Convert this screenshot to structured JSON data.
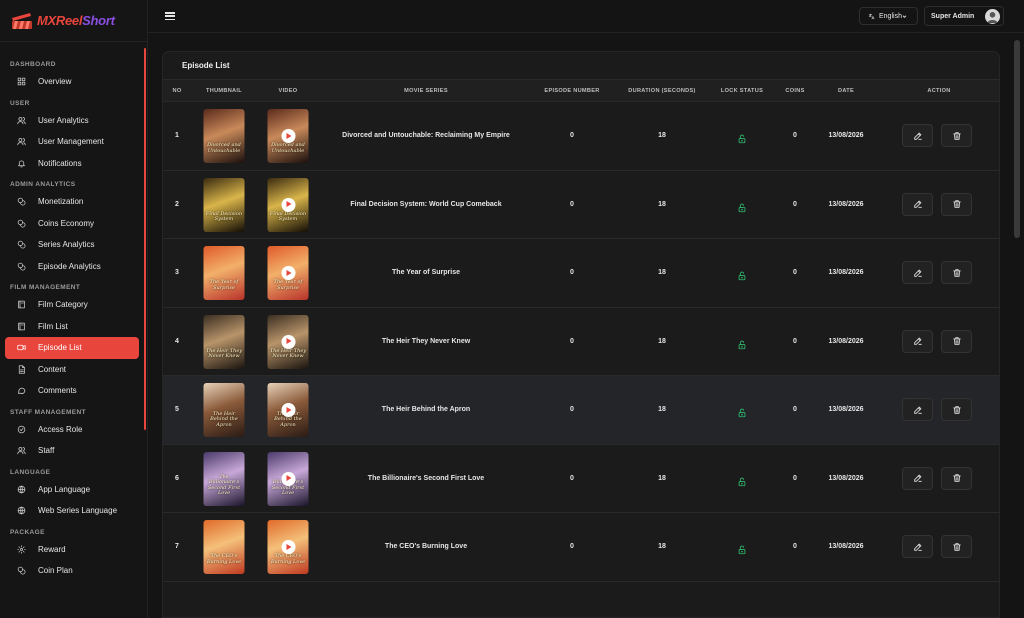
{
  "app": {
    "logo_main": "MXReel",
    "logo_sub": "Short"
  },
  "sidebar": {
    "sections": [
      {
        "label": "DASHBOARD",
        "items": [
          {
            "label": "Overview",
            "icon": "grid-icon"
          }
        ]
      },
      {
        "label": "USER",
        "items": [
          {
            "label": "User Analytics",
            "icon": "users-icon"
          },
          {
            "label": "User Management",
            "icon": "users-icon"
          },
          {
            "label": "Notifications",
            "icon": "bell-icon"
          }
        ]
      },
      {
        "label": "ADMIN ANALYTICS",
        "items": [
          {
            "label": "Monetization",
            "icon": "coins-icon"
          },
          {
            "label": "Coins Economy",
            "icon": "coins-icon"
          },
          {
            "label": "Series Analytics",
            "icon": "coins-icon"
          },
          {
            "label": "Episode Analytics",
            "icon": "coins-icon"
          }
        ]
      },
      {
        "label": "FILM MANAGEMENT",
        "items": [
          {
            "label": "Film Category",
            "icon": "book-icon"
          },
          {
            "label": "Film List",
            "icon": "book-icon"
          },
          {
            "label": "Episode List",
            "icon": "video-icon",
            "active": true
          },
          {
            "label": "Content",
            "icon": "file-icon"
          },
          {
            "label": "Comments",
            "icon": "comment-icon"
          }
        ]
      },
      {
        "label": "STAFF MANAGEMENT",
        "items": [
          {
            "label": "Access Role",
            "icon": "shield-icon"
          },
          {
            "label": "Staff",
            "icon": "users-icon"
          }
        ]
      },
      {
        "label": "LANGUAGE",
        "items": [
          {
            "label": "App Language",
            "icon": "globe-icon"
          },
          {
            "label": "Web Series Language",
            "icon": "globe-icon"
          }
        ]
      },
      {
        "label": "PACKAGE",
        "items": [
          {
            "label": "Reward",
            "icon": "gift-icon"
          },
          {
            "label": "Coin Plan",
            "icon": "coins-icon"
          }
        ]
      }
    ]
  },
  "topbar": {
    "language": "English",
    "user_name": "Super Admin"
  },
  "card": {
    "title": "Episode List"
  },
  "table": {
    "columns": [
      "NO",
      "THUMBNAIL",
      "VIDEO",
      "MOVIE SERIES",
      "EPISODE NUMBER",
      "DURATION (SECONDS)",
      "LOCK STATUS",
      "COINS",
      "DATE",
      "ACTION"
    ],
    "rows": [
      {
        "no": "1",
        "series": "Divorced and Untouchable: Reclaiming My Empire",
        "thumb_text": "Divorced and Untouchable",
        "episode": "0",
        "duration": "18",
        "coins": "0",
        "date": "13/08/2026",
        "colors": [
          "#5a2a1c",
          "#c98a5a",
          "#1a0f0c"
        ]
      },
      {
        "no": "2",
        "series": "Final Decision System: World Cup Comeback",
        "thumb_text": "Final Decision System",
        "episode": "0",
        "duration": "18",
        "coins": "0",
        "date": "13/08/2026",
        "colors": [
          "#3a2a10",
          "#d9b54a",
          "#120c05"
        ]
      },
      {
        "no": "3",
        "series": "The Year of Surprise",
        "thumb_text": "The Year of Surprise",
        "episode": "0",
        "duration": "18",
        "coins": "0",
        "date": "13/08/2026",
        "colors": [
          "#e05a2a",
          "#f2b06a",
          "#b8322a"
        ]
      },
      {
        "no": "4",
        "series": "The Heir They Never Knew",
        "thumb_text": "The Heir They Never Knew",
        "episode": "0",
        "duration": "18",
        "coins": "0",
        "date": "13/08/2026",
        "colors": [
          "#3a2e22",
          "#b8946a",
          "#1a140e"
        ]
      },
      {
        "no": "5",
        "series": "The Heir Behind the Apron",
        "thumb_text": "The Heir Behind the Apron",
        "episode": "0",
        "duration": "18",
        "coins": "0",
        "date": "13/08/2026",
        "colors": [
          "#e8d2b8",
          "#8a5a3a",
          "#2a1a14"
        ]
      },
      {
        "no": "6",
        "series": "The Billionaire's Second First Love",
        "thumb_text": "The Billionaire's Second First Love",
        "episode": "0",
        "duration": "18",
        "coins": "0",
        "date": "13/08/2026",
        "colors": [
          "#4a3a6a",
          "#c8a8d8",
          "#1a142a"
        ]
      },
      {
        "no": "7",
        "series": "The CEO's Burning Love",
        "thumb_text": "The CEO's Burning Love",
        "episode": "0",
        "duration": "18",
        "coins": "0",
        "date": "13/08/2026",
        "colors": [
          "#e06a2a",
          "#f4c07a",
          "#c03a22"
        ]
      }
    ]
  },
  "colors": {
    "accent": "#e8453c",
    "lock_green": "#2fbf71"
  }
}
